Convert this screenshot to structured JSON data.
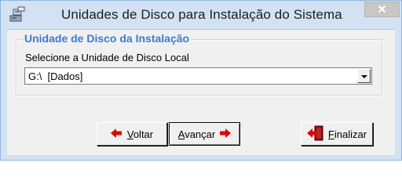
{
  "window": {
    "title": "Unidades de Disco para Instalação do Sistema",
    "close_label": "✕"
  },
  "group": {
    "legend": "Unidade de Disco da Instalação",
    "field_label": "Selecione a Unidade de Disco Local",
    "drive_value": "G:\\  [Dados]"
  },
  "buttons": {
    "back_accel": "V",
    "back_rest": "oltar",
    "next_accel": "A",
    "next_rest": "vançar",
    "finish_accel": "F",
    "finish_rest": "inalizar"
  },
  "colors": {
    "accent": "#3a7bd5",
    "arrow_red": "#e00000",
    "title_bar": "#d2e2f3"
  }
}
